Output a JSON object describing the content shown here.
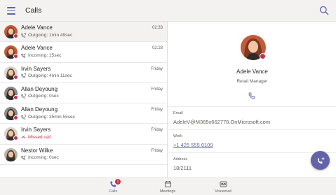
{
  "header": {
    "title": "Calls"
  },
  "calls": [
    {
      "name": "Adele Vance",
      "detail": "Outgoing: 1min 49sec",
      "time": "02:33",
      "type": "outgoing",
      "presence": "#c4314b",
      "avatar_bg": "#c45a3a",
      "hair": "#7a3b22"
    },
    {
      "name": "Adele Vance",
      "detail": "Incoming: 15sec",
      "time": "02:28",
      "type": "incoming",
      "presence": "#c4314b",
      "avatar_bg": "#c45a3a",
      "hair": "#7a3b22"
    },
    {
      "name": "Irvin Sayers",
      "detail": "Outgoing: 4min 11sec",
      "time": "Friday",
      "type": "outgoing",
      "presence": "#c4314b",
      "avatar_bg": "#d9d4cc",
      "hair": "#5a4632"
    },
    {
      "name": "Allan Deyoung",
      "detail": "Outgoing: 0sec",
      "time": "Friday",
      "type": "outgoing",
      "presence": "#c4314b",
      "avatar_bg": "#8a8a8a",
      "hair": "#2f2f2f"
    },
    {
      "name": "Allan Deyoung",
      "detail": "Outgoing: 35min 55sec",
      "time": "Friday",
      "type": "outgoing",
      "presence": "#c4314b",
      "avatar_bg": "#8a8a8a",
      "hair": "#2f2f2f"
    },
    {
      "name": "Irvin Sayers",
      "detail": "Missed call",
      "time": "Friday",
      "type": "missed",
      "presence": "#c4314b",
      "avatar_bg": "#d9d4cc",
      "hair": "#5a4632"
    },
    {
      "name": "Nestor Wilke",
      "detail": "Incoming: 0sec",
      "time": "Friday",
      "type": "incoming",
      "presence": "",
      "avatar_bg": "#b9b2a8",
      "hair": "#4a3a2e"
    }
  ],
  "profile": {
    "name": "Adele Vance",
    "role": "Retail Manager",
    "email_label": "Email",
    "email": "AdeleV@M365x662778.OnMicrosoft.com",
    "work_label": "Work",
    "work_phone": "+1 425 555 0109",
    "address_label": "Address",
    "address": "18/2111"
  },
  "nav": {
    "calls_label": "Calls",
    "calls_badge": "1",
    "meetings_label": "Meetings",
    "voicemail_label": "Voicemail"
  },
  "colors": {
    "accent": "#6264a7",
    "missed": "#c4314b",
    "busy": "#c4314b"
  }
}
